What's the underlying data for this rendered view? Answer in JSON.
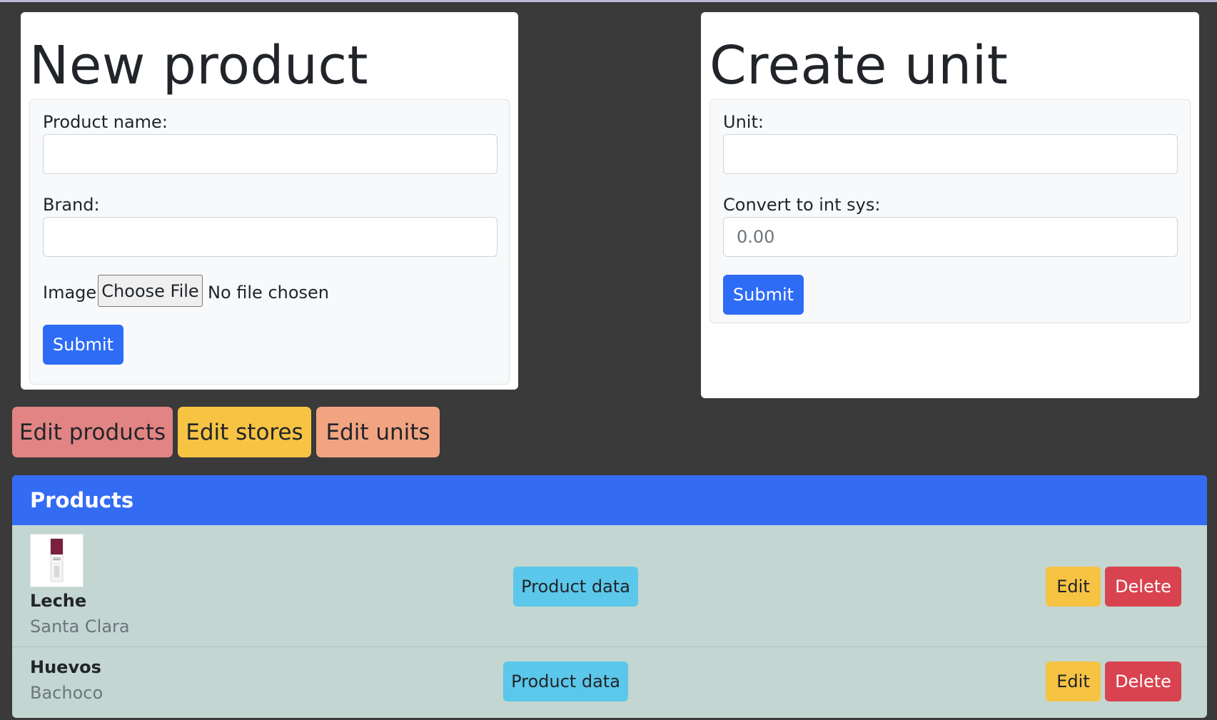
{
  "new_product": {
    "title": "New product",
    "product_name_label": "Product name:",
    "product_name_value": "",
    "brand_label": "Brand:",
    "brand_value": "",
    "image_label": "Image:",
    "choose_file_label": "Choose File",
    "no_file_text": "No file chosen",
    "submit_label": "Submit"
  },
  "create_unit": {
    "title": "Create unit",
    "unit_label": "Unit:",
    "unit_value": "",
    "convert_label": "Convert to int sys:",
    "convert_placeholder": "0.00",
    "submit_label": "Submit"
  },
  "actions": {
    "edit_products": "Edit products",
    "edit_stores": "Edit stores",
    "edit_units": "Edit units"
  },
  "products": {
    "header": "Products",
    "items": [
      {
        "name": "Leche",
        "brand": "Santa Clara",
        "data_label": "Product data",
        "edit_label": "Edit",
        "delete_label": "Delete",
        "has_image": true
      },
      {
        "name": "Huevos",
        "brand": "Bachoco",
        "data_label": "Product data",
        "edit_label": "Edit",
        "delete_label": "Delete",
        "has_image": false
      }
    ]
  },
  "colors": {
    "background": "#3a3a3a",
    "primary": "#2e6cf6",
    "edit_products": "#e28484",
    "edit_stores": "#f6c343",
    "edit_units": "#f2a482",
    "info": "#5bc7ea",
    "danger": "#d8434f",
    "list_bg": "#c3d6d1"
  }
}
